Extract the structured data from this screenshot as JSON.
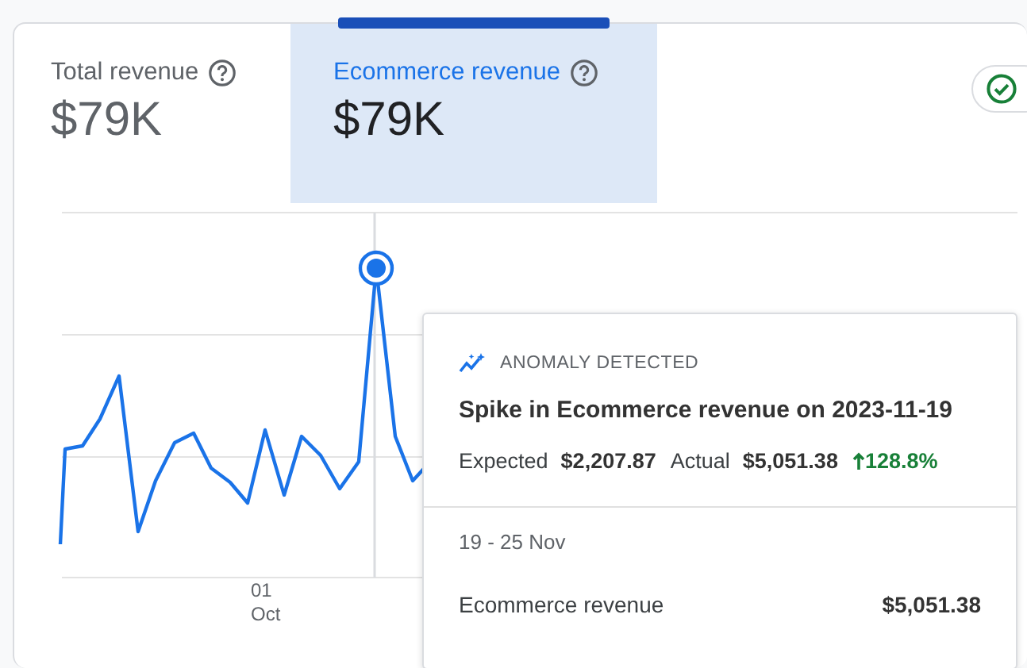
{
  "tabs": [
    {
      "label": "Total revenue",
      "value": "$79K",
      "selected": false
    },
    {
      "label": "Ecommerce revenue",
      "value": "$79K",
      "selected": true
    }
  ],
  "chart": {
    "x_labels": [
      {
        "day": "01",
        "month": "Oct"
      }
    ]
  },
  "tooltip": {
    "badge": "ANOMALY DETECTED",
    "title": "Spike in Ecommerce revenue on 2023-11-19",
    "expected_label": "Expected",
    "expected_value": "$2,207.87",
    "actual_label": "Actual",
    "actual_value": "$5,051.38",
    "change": "128.8%",
    "date_range": "19 - 25 Nov",
    "rows": [
      {
        "label": "Ecommerce revenue",
        "value": "$5,051.38"
      }
    ]
  }
}
